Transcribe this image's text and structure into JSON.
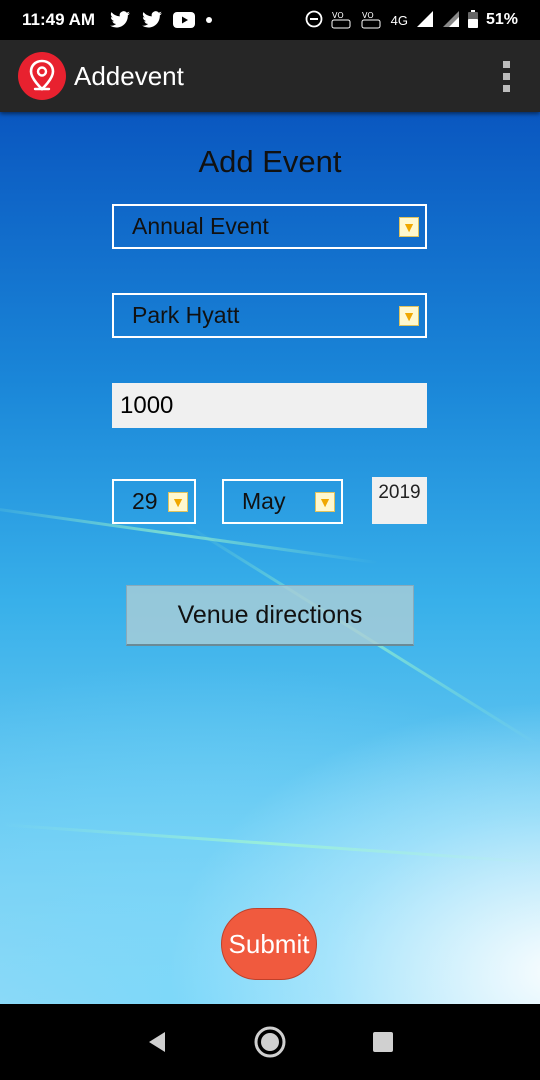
{
  "status_bar": {
    "time": "11:49 AM",
    "battery": "51%",
    "network": "4G",
    "icons": [
      "twitter-icon",
      "twitter-icon",
      "youtube-icon",
      "dot-icon",
      "dnd-icon",
      "volte-icon",
      "volte-icon",
      "signal-icon",
      "signal-icon",
      "battery-icon"
    ]
  },
  "app_bar": {
    "title": "Addevent",
    "logo_icon": "location-pin-icon",
    "menu_icon": "overflow-menu-icon"
  },
  "form": {
    "title": "Add Event",
    "event_type": "Annual Event",
    "venue": "Park Hyatt",
    "amount": "1000",
    "day": "29",
    "month": "May",
    "year": "2019",
    "venue_directions_label": "Venue directions",
    "submit_label": "Submit"
  },
  "nav_bar": {
    "buttons": [
      "back-icon",
      "home-icon",
      "recents-icon"
    ]
  },
  "colors": {
    "app_bar": "#262626",
    "logo": "#e8212f",
    "submit": "#f05a3e",
    "spinner_border": "#ffffff",
    "field_bg": "#f0f0f0"
  }
}
